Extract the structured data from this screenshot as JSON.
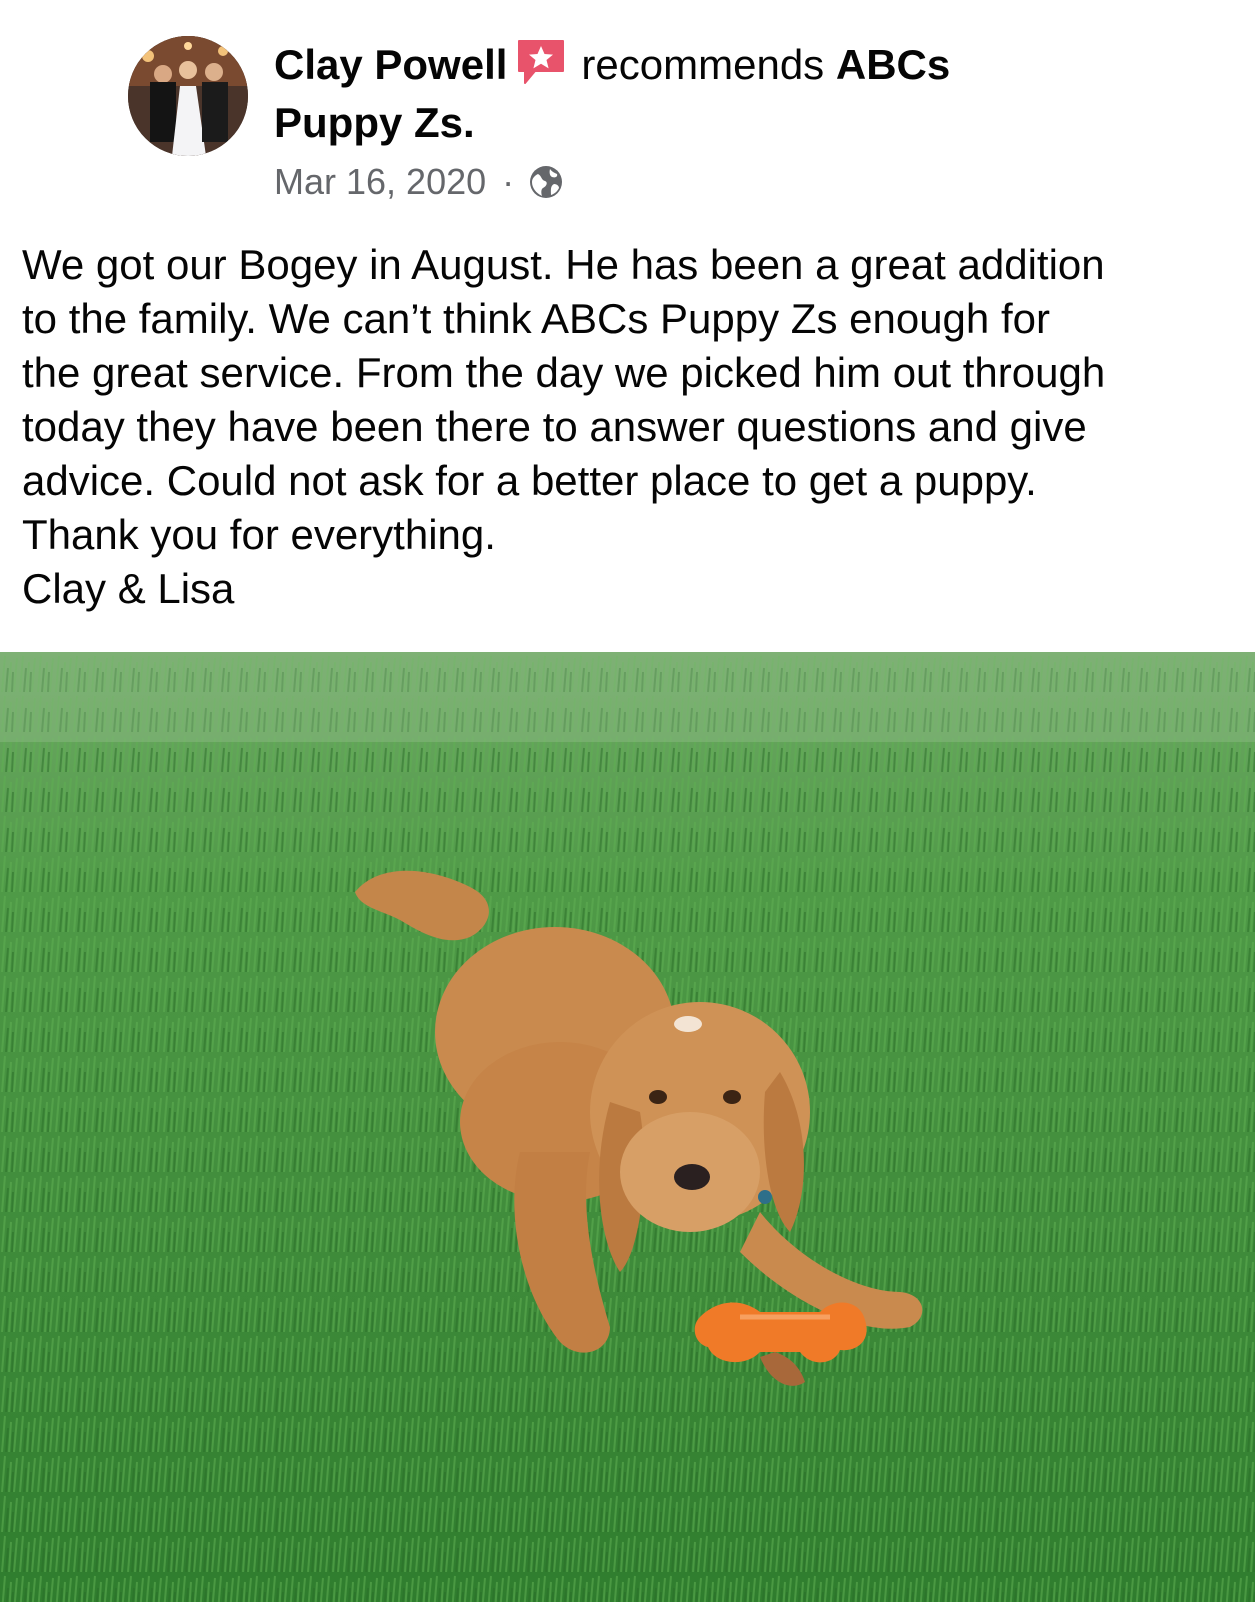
{
  "post": {
    "author": "Clay Powell",
    "action": "recommends",
    "page_name_line1": "ABCs",
    "page_name_line2": "Puppy Zs.",
    "date": "Mar 16, 2020",
    "separator": "·",
    "privacy_icon": "globe-icon",
    "badge_icon": "recommendation-star-icon",
    "body_lines": [
      "We got our Bogey in August. He has been a great addition",
      "to the family. We can’t think ABCs Puppy Zs enough for",
      "the great service. From the day we picked him out through",
      "today they have been there to answer questions and give",
      "advice. Could not ask for a better place to get a puppy.",
      "Thank you for everything.",
      "Clay & Lisa"
    ]
  },
  "colors": {
    "badge": "#e8536b",
    "meta_text": "#65676b",
    "text": "#050505",
    "grass": "#3f8f3a",
    "dog": "#c98a4e",
    "toy": "#f07a28"
  }
}
